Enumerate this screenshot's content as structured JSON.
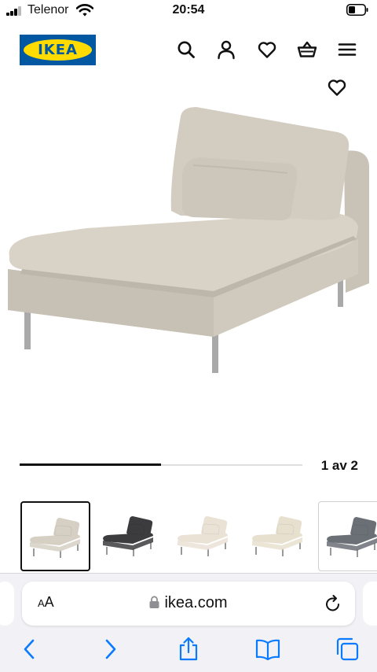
{
  "status_bar": {
    "carrier": "Telenor",
    "time": "20:54",
    "icons": [
      "signal-icon",
      "wifi-icon",
      "battery-icon"
    ]
  },
  "header": {
    "logo_text": "IKEA",
    "brand_colors": {
      "blue": "#0058a3",
      "yellow": "#ffdb00"
    },
    "icons": [
      "search-icon",
      "account-icon",
      "wishlist-icon",
      "cart-icon",
      "menu-icon"
    ]
  },
  "product": {
    "favorite_icon": "heart-icon",
    "fabric_color": "#d6d0c4"
  },
  "carousel": {
    "counter": "1 av 2",
    "progress_fraction": 0.5
  },
  "thumbnails": [
    {
      "variant": "beige",
      "color": "#d6d0c4",
      "selected": true
    },
    {
      "variant": "dark-grey",
      "color": "#3c3c3e",
      "selected": false
    },
    {
      "variant": "light-beige",
      "color": "#ebe2d6",
      "selected": false
    },
    {
      "variant": "cream",
      "color": "#e8e0cf",
      "selected": false
    },
    {
      "variant": "blue-grey",
      "color": "#6b7077",
      "selected": false
    }
  ],
  "browser": {
    "text_size_button_small": "A",
    "text_size_button_large": "A",
    "url": "ikea.com",
    "icons": [
      "lock-icon",
      "reload-icon",
      "back-icon",
      "forward-icon",
      "share-icon",
      "bookmarks-icon",
      "tabs-icon"
    ],
    "accent_color": "#0a7aff"
  }
}
